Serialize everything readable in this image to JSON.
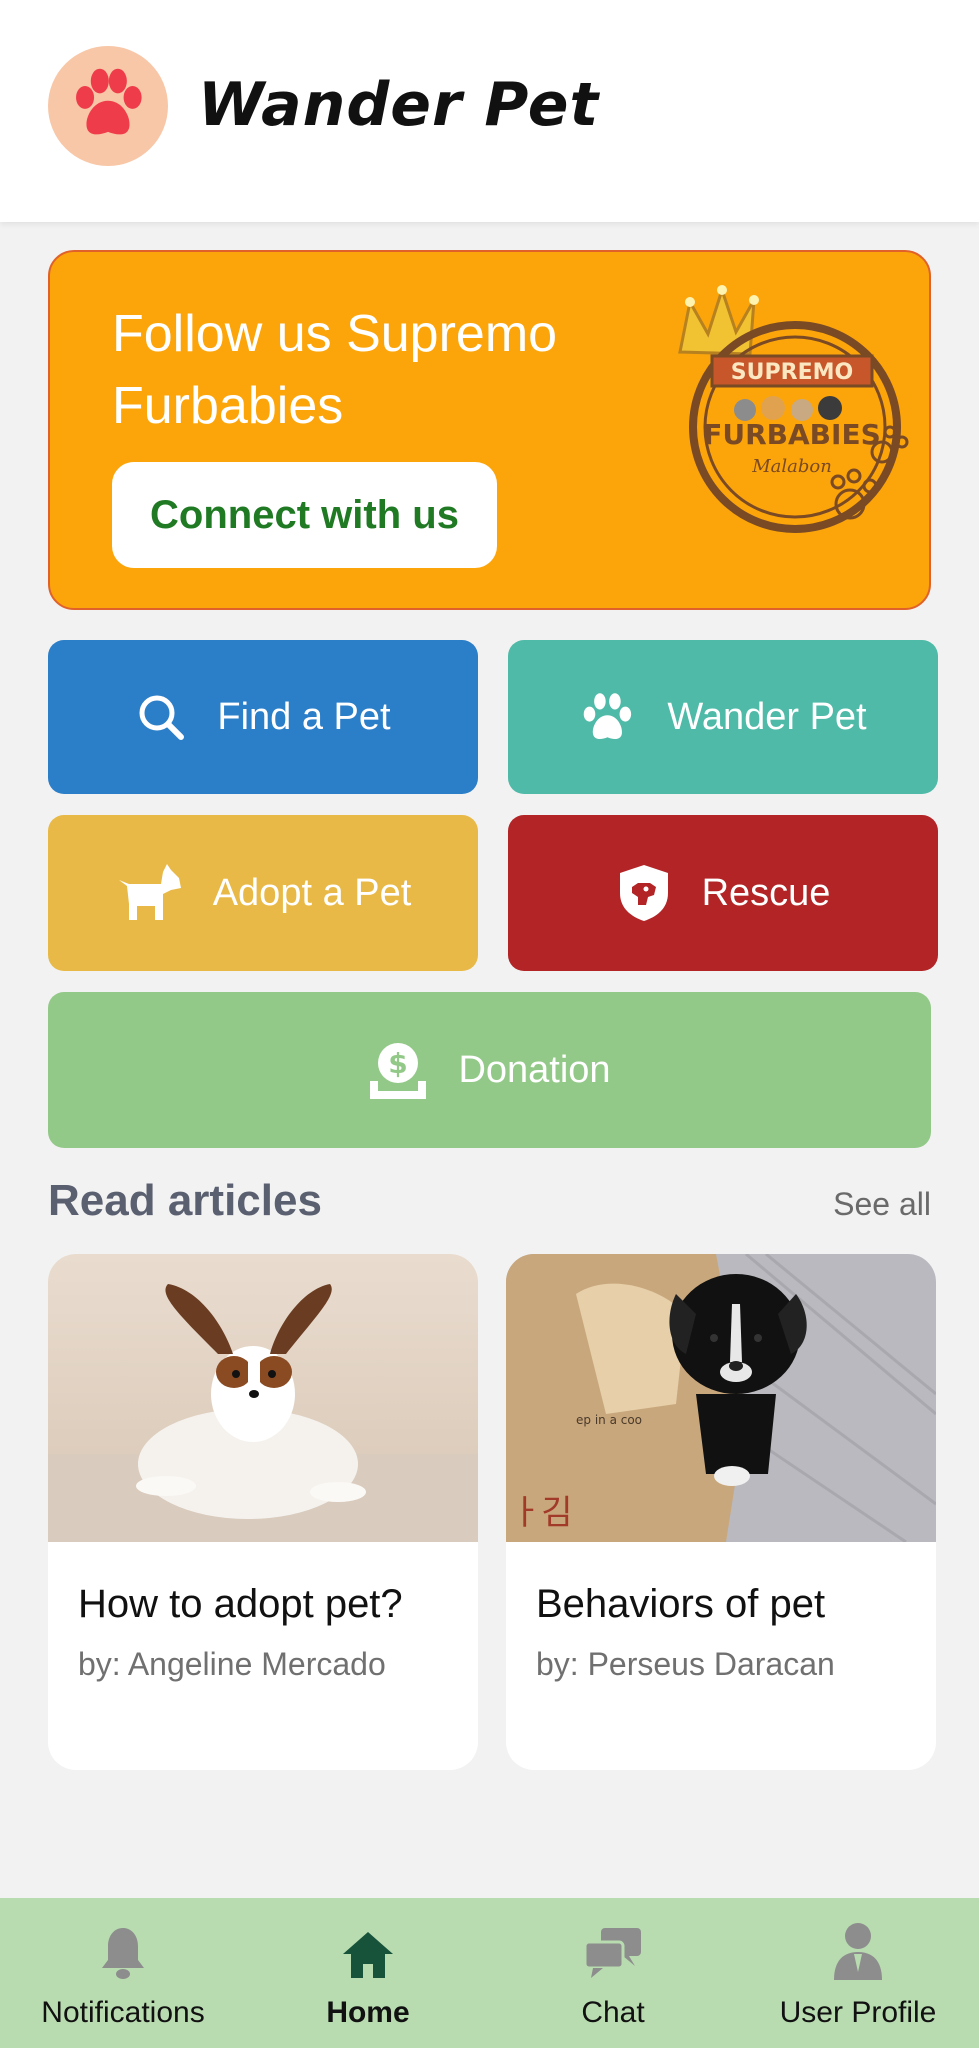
{
  "header": {
    "app_title": "Wander Pet",
    "logo_icon": "paw-icon"
  },
  "banner": {
    "title": "Follow us Supremo Furbabies",
    "button_label": "Connect with us",
    "brand_logo_text_top": "SUPREMO",
    "brand_logo_text_main": "FURBABIES",
    "brand_logo_text_sub": "Malabon",
    "color": "#fca50b"
  },
  "actions": {
    "find": {
      "label": "Find a Pet",
      "icon": "search-icon",
      "color": "#2b7ec8"
    },
    "wander": {
      "label": "Wander Pet",
      "icon": "paw-icon",
      "color": "#4fbaa8"
    },
    "adopt": {
      "label": "Adopt a Pet",
      "icon": "dog-icon",
      "color": "#e8b946"
    },
    "rescue": {
      "label": "Rescue",
      "icon": "shield-dog-icon",
      "color": "#b22426"
    },
    "donation": {
      "label": "Donation",
      "icon": "donation-icon",
      "color": "#93c988"
    }
  },
  "articles": {
    "section_title": "Read articles",
    "see_all": "See all",
    "items": [
      {
        "title": "How to adopt pet?",
        "author": "by: Angeline Mercado"
      },
      {
        "title": "Behaviors of pet",
        "author": "by: Perseus Daracan",
        "image_text": "ep in a coo",
        "image_text2": "ㅏ김"
      }
    ]
  },
  "bottom_nav": {
    "items": [
      {
        "label": "Notifications",
        "icon": "bell-icon"
      },
      {
        "label": "Home",
        "icon": "home-icon",
        "active": true
      },
      {
        "label": "Chat",
        "icon": "chat-icon"
      },
      {
        "label": "User Profile",
        "icon": "user-icon"
      }
    ]
  }
}
